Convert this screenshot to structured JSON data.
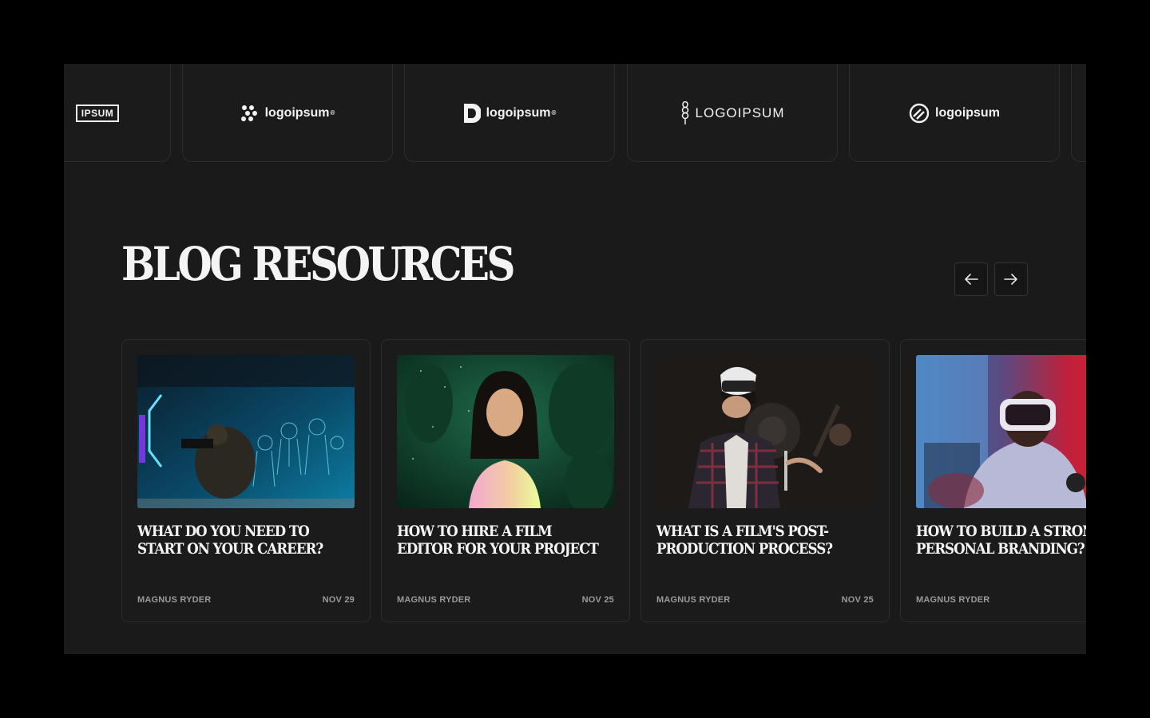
{
  "logos": [
    {
      "text": "IPSUM",
      "icon": "boxed-wordmark"
    },
    {
      "text": "logoipsum",
      "icon": "cluster-icon",
      "suffix": "®"
    },
    {
      "text": "logoipsum",
      "icon": "d-shape-icon",
      "suffix": "®"
    },
    {
      "text": "LOGOIPSUM",
      "icon": "wheat-icon"
    },
    {
      "text": "logoipsum",
      "icon": "slashed-circle-icon"
    }
  ],
  "section": {
    "title": "BLOG RESOURCES",
    "prev_label": "previous",
    "next_label": "next"
  },
  "posts": [
    {
      "title": "What do you need to start on your career?",
      "author": "MAGNUS RYDER",
      "date": "NOV 29",
      "image": "man-with-camera-blue-neon"
    },
    {
      "title": "How to hire a film editor for your project",
      "author": "MAGNUS RYDER",
      "date": "NOV 25",
      "image": "girl-in-green-foliage"
    },
    {
      "title": "What is a film's post-production process?",
      "author": "MAGNUS RYDER",
      "date": "NOV 25",
      "image": "woman-with-vr-headset"
    },
    {
      "title": "How to build a strong personal branding?",
      "author": "MAGNUS RYDER",
      "date": "",
      "image": "man-with-vr-red-light"
    }
  ],
  "colors": {
    "background": "#1a1a1a",
    "page": "#000000",
    "card_border": "#2c2c2c",
    "meta_text": "#9a9a9a"
  }
}
